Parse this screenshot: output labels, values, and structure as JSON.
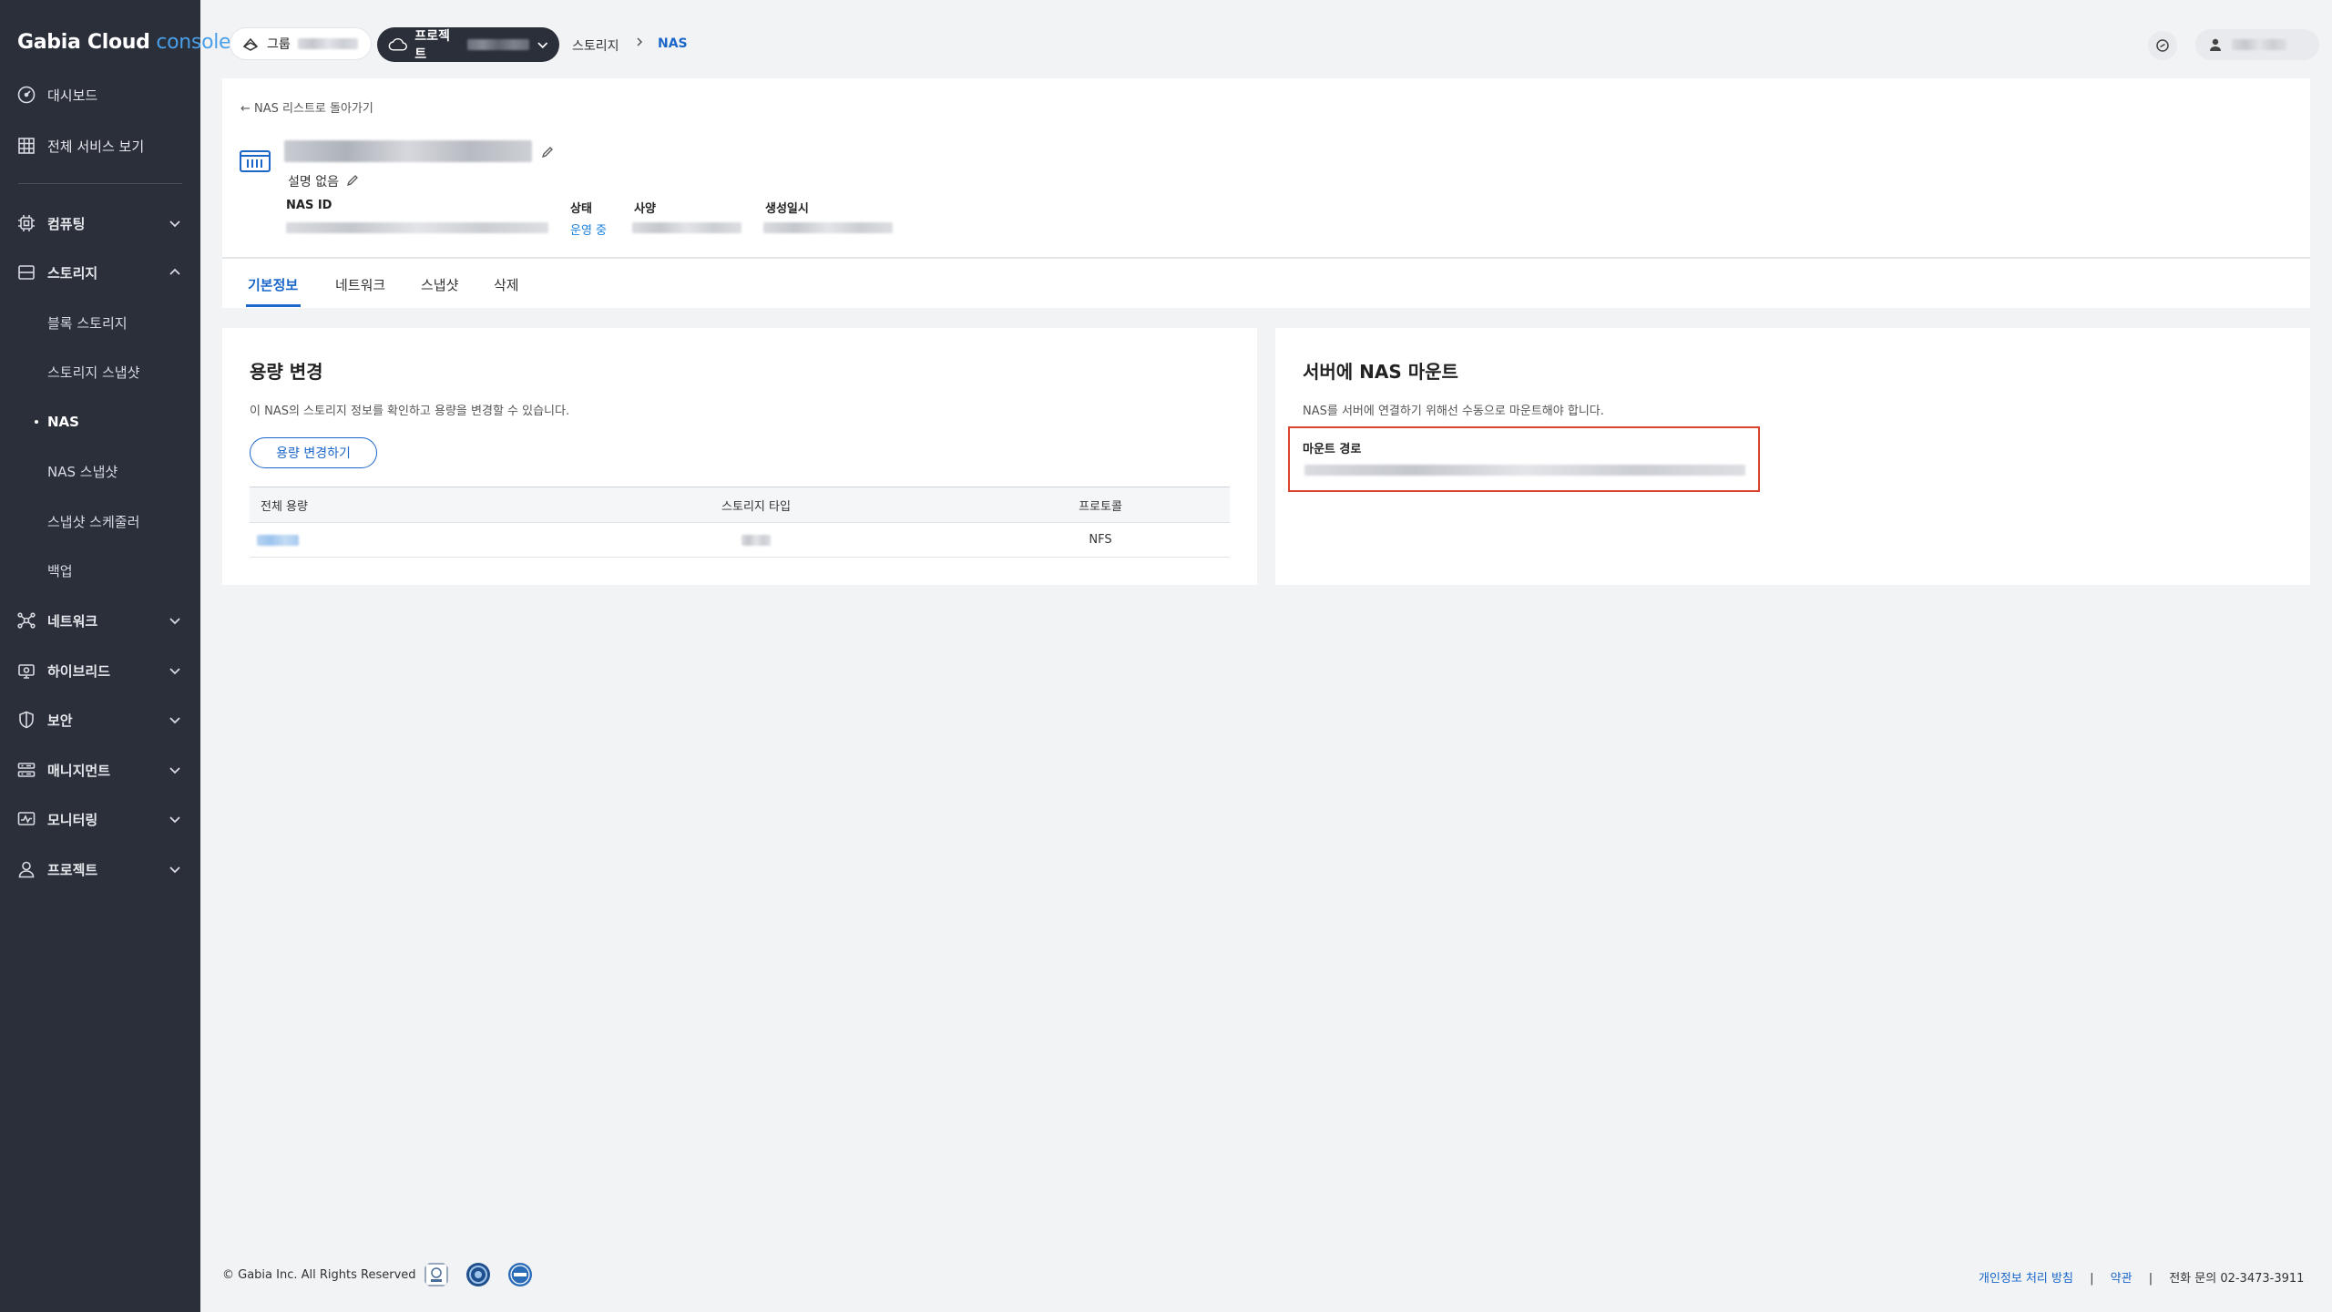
{
  "app": {
    "brand": "Gabia Cloud",
    "suffix": "console"
  },
  "sidebar": {
    "top_items": [
      {
        "label": "대시보드",
        "icon": "dashboard-icon"
      },
      {
        "label": "전체 서비스 보기",
        "icon": "grid-icon"
      }
    ],
    "groups": [
      {
        "label": "컴퓨팅",
        "icon": "cpu-icon",
        "expanded": false
      },
      {
        "label": "스토리지",
        "icon": "storage-icon",
        "expanded": true,
        "children": [
          "블록 스토리지",
          "스토리지 스냅샷",
          "NAS",
          "NAS 스냅샷",
          "스냅샷 스케줄러",
          "백업"
        ],
        "active_child": "NAS"
      },
      {
        "label": "네트워크",
        "icon": "network-icon",
        "expanded": false
      },
      {
        "label": "하이브리드",
        "icon": "hybrid-icon",
        "expanded": false
      },
      {
        "label": "보안",
        "icon": "shield-icon",
        "expanded": false
      },
      {
        "label": "매니지먼트",
        "icon": "management-icon",
        "expanded": false
      },
      {
        "label": "모니터링",
        "icon": "monitoring-icon",
        "expanded": false
      },
      {
        "label": "프로젝트",
        "icon": "user-icon",
        "expanded": false
      }
    ]
  },
  "header": {
    "group_label": "그룹",
    "project_label": "프로젝트",
    "breadcrumb": [
      "스토리지",
      "NAS"
    ]
  },
  "detail": {
    "back_label": "← NAS 리스트로 돌아가기",
    "description": "설명 없음",
    "meta_labels": {
      "nas_id": "NAS ID",
      "status": "상태",
      "spec": "사양",
      "created_at": "생성일시"
    },
    "status_value": "운영 중",
    "tabs": [
      "기본정보",
      "네트워크",
      "스냅샷",
      "삭제"
    ],
    "active_tab": "기본정보"
  },
  "capacity_panel": {
    "title": "용량 변경",
    "description": "이 NAS의 스토리지 정보를 확인하고 용량을 변경할 수 있습니다.",
    "button_label": "용량 변경하기",
    "columns": [
      "전체 용량",
      "스토리지 타입",
      "프로토콜"
    ],
    "rows": [
      {
        "protocol": "NFS"
      }
    ]
  },
  "mount_panel": {
    "title": "서버에 NAS 마운트",
    "description": "NAS를 서버에 연결하기 위해선 수동으로 마운트해야 합니다.",
    "mount_path_label": "마운트 경로"
  },
  "footer": {
    "copyright": "© Gabia Inc. All Rights Reserved",
    "privacy_label": "개인정보 처리 방침",
    "terms_label": "약관",
    "phone_label": "전화 문의 02-3473-3911"
  },
  "colors": {
    "sidebar_bg": "#2a2f3a",
    "accent": "#1a66c9",
    "highlight_border": "#d9452b"
  }
}
